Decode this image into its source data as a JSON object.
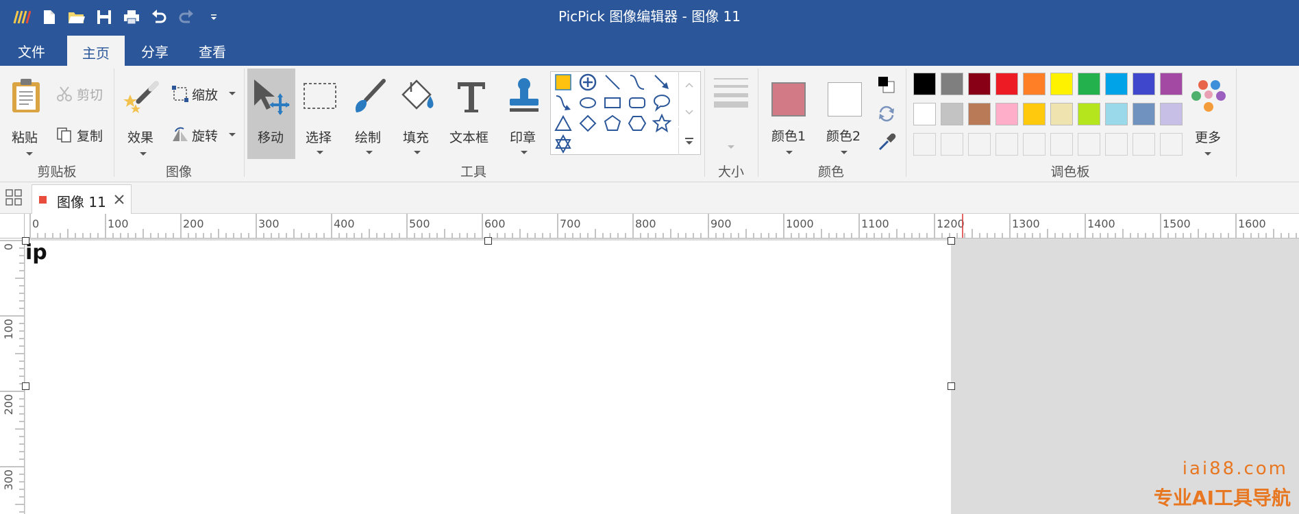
{
  "window": {
    "title": "PicPick 图像编辑器 - 图像 11"
  },
  "quick_access": {
    "icons": [
      "app-logo-icon",
      "new-file-icon",
      "open-folder-icon",
      "save-icon",
      "print-icon",
      "undo-icon",
      "redo-icon",
      "customize-dropdown-icon"
    ]
  },
  "menu": {
    "tabs": [
      {
        "label": "文件",
        "active": false
      },
      {
        "label": "主页",
        "active": true
      },
      {
        "label": "分享",
        "active": false
      },
      {
        "label": "查看",
        "active": false
      }
    ]
  },
  "ribbon": {
    "clipboard": {
      "group_label": "剪贴板",
      "paste": "粘贴",
      "cut": "剪切",
      "copy": "复制"
    },
    "image": {
      "group_label": "图像",
      "effects": "效果",
      "resize": "缩放",
      "rotate": "旋转"
    },
    "tools": {
      "group_label": "工具",
      "move": "移动",
      "select": "选择",
      "draw": "绘制",
      "fill": "填充",
      "textbox": "文本框",
      "stamp": "印章"
    },
    "size": {
      "group_label": "大小"
    },
    "colors": {
      "group_label": "颜色",
      "color1": "颜色1",
      "color2": "颜色2",
      "color1_value": "#d27a86",
      "color2_value": "#ffffff"
    },
    "palette": {
      "group_label": "调色板",
      "more": "更多",
      "row1": [
        "#000000",
        "#7f7f7f",
        "#880015",
        "#ed1c24",
        "#ff7f27",
        "#fff200",
        "#22b14c",
        "#00a2e8",
        "#3f48cc",
        "#a349a4"
      ],
      "row2": [
        "#ffffff",
        "#c3c3c3",
        "#b97a57",
        "#ffaec9",
        "#ffc90e",
        "#efe4b0",
        "#b5e61d",
        "#99d9ea",
        "#7092be",
        "#c8bfe7"
      ]
    }
  },
  "shape_gallery": {
    "shapes": [
      "rectangle-select-icon",
      "crosshair-icon",
      "line-icon",
      "curve-icon",
      "arrow-icon",
      "curved-arrow-icon",
      "ellipse-icon",
      "rectangle-icon",
      "rounded-rect-icon",
      "speech-bubble-icon",
      "triangle-icon",
      "diamond-icon",
      "pentagon-icon",
      "hexagon-icon",
      "star-icon",
      "star-of-david-icon"
    ]
  },
  "doc_tabs": {
    "tab_label": "图像 11"
  },
  "rulers": {
    "h_labels": [
      "0",
      "100",
      "200",
      "300",
      "400",
      "500",
      "600",
      "700",
      "800",
      "900",
      "1000",
      "1100",
      "1200",
      "1300",
      "1400",
      "1500",
      "1600"
    ],
    "v_labels": [
      "0",
      "100",
      "200",
      "300"
    ]
  },
  "canvas": {
    "text": "ip"
  },
  "watermark": {
    "url": "iai88.com",
    "text": "专业AI工具导航"
  },
  "theme": {
    "accent": "#2b579a",
    "ribbon_bg": "#f3f3f3",
    "workspace_bg": "#dcdcdc"
  }
}
